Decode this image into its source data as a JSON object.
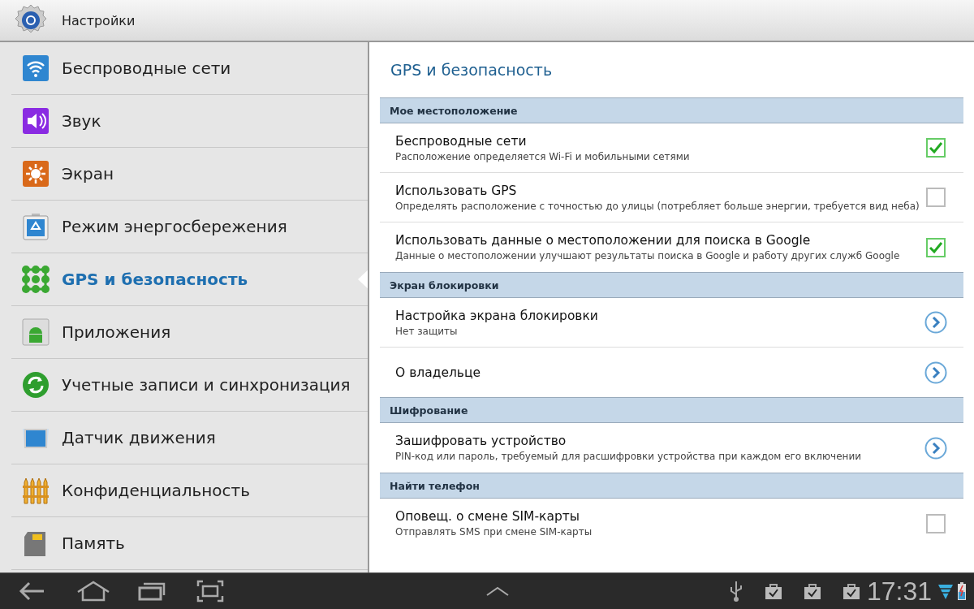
{
  "header": {
    "title": "Настройки"
  },
  "sidebar": {
    "items": [
      {
        "label": "Беспроводные сети",
        "selected": false
      },
      {
        "label": "Звук",
        "selected": false
      },
      {
        "label": "Экран",
        "selected": false
      },
      {
        "label": "Режим энергосбережения",
        "selected": false
      },
      {
        "label": "GPS и безопасность",
        "selected": true
      },
      {
        "label": "Приложения",
        "selected": false
      },
      {
        "label": "Учетные записи и синхронизация",
        "selected": false
      },
      {
        "label": "Датчик движения",
        "selected": false
      },
      {
        "label": "Конфиденциальность",
        "selected": false
      },
      {
        "label": "Память",
        "selected": false
      }
    ]
  },
  "panel": {
    "title": "GPS и безопасность",
    "sections": [
      {
        "title": "Мое местоположение",
        "items": [
          {
            "kind": "checkbox",
            "title": "Беспроводные сети",
            "subtitle": "Расположение определяется Wi-Fi и мобильными сетями",
            "checked": true
          },
          {
            "kind": "checkbox",
            "title": "Использовать GPS",
            "subtitle": "Определять расположение с точностью до улицы (потребляет больше энергии, требуется вид неба)",
            "checked": false
          },
          {
            "kind": "checkbox",
            "title": "Использовать данные о местоположении для поиска в Google",
            "subtitle": "Данные о местоположении улучшают результаты поиска в Google и работу других служб Google",
            "checked": true
          }
        ]
      },
      {
        "title": "Экран блокировки",
        "items": [
          {
            "kind": "chevron",
            "title": "Настройка экрана блокировки",
            "subtitle": "Нет защиты"
          },
          {
            "kind": "chevron",
            "title": "О владельце"
          }
        ]
      },
      {
        "title": "Шифрование",
        "items": [
          {
            "kind": "chevron",
            "title": "Зашифровать устройство",
            "subtitle": "PIN-код или пароль, требуемый для расшифровки устройства при каждом его включении"
          }
        ]
      },
      {
        "title": "Найти телефон",
        "items": [
          {
            "kind": "checkbox",
            "title": "Оповещ. о смене SIM-карты",
            "subtitle": "Отправлять SMS при смене SIM-карты",
            "checked": false
          }
        ]
      }
    ]
  },
  "status_bar": {
    "time": "17:31"
  }
}
